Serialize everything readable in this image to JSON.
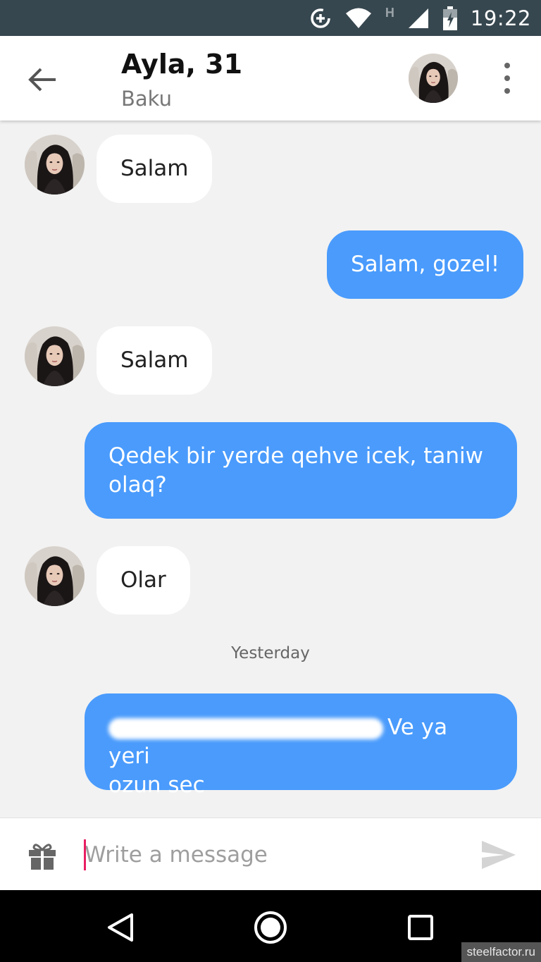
{
  "status_bar": {
    "time": "19:22",
    "network_label": "H"
  },
  "header": {
    "title": "Ayla, 31",
    "subtitle": "Baku"
  },
  "messages": [
    {
      "sender": "them",
      "text": "Salam"
    },
    {
      "sender": "me",
      "text": "Salam, gozel!"
    },
    {
      "sender": "them",
      "text": "Salam"
    },
    {
      "sender": "me",
      "text": "Qedek bir yerde qehve icek, taniw olaq?"
    },
    {
      "sender": "them",
      "text": "Olar"
    },
    {
      "sender": "me",
      "text_visible_line1": "Ve ya yeri",
      "text_visible_line2": "ozun sec"
    }
  ],
  "date_separator": "Yesterday",
  "composer": {
    "placeholder": "Write a message"
  },
  "icons": [
    "data-saver-icon",
    "wifi-icon",
    "signal-icon",
    "battery-icon",
    "back-arrow-icon",
    "more-vert-icon",
    "gift-icon",
    "send-icon",
    "nav-back-icon",
    "nav-home-icon",
    "nav-recents-icon"
  ],
  "colors": {
    "status_bar": "#37474f",
    "outgoing_bubble": "#4a9bfc",
    "incoming_bubble": "#ffffff",
    "chat_bg": "#f2f2f2",
    "cursor": "#e91e63"
  },
  "watermark": "steelfactor.ru"
}
